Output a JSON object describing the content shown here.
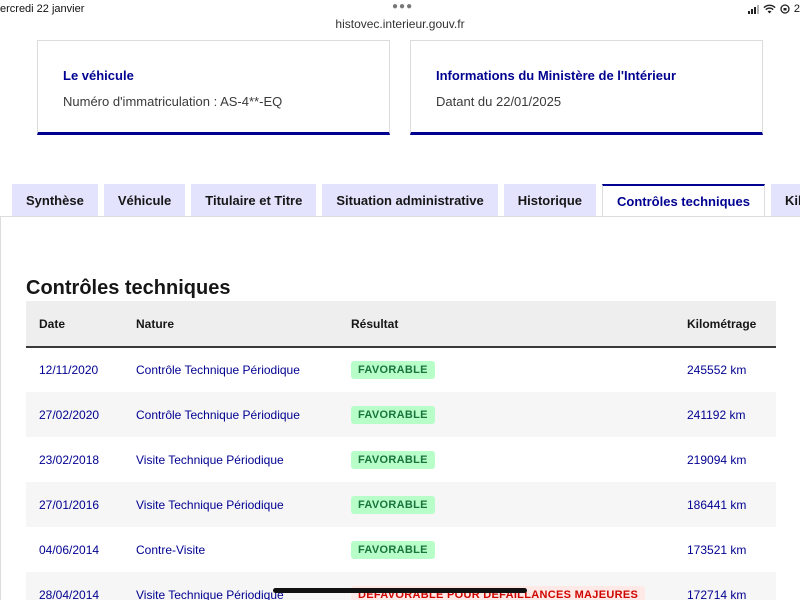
{
  "status_bar": {
    "date": "ercredi 22 janvier",
    "url": "histovec.interieur.gouv.fr",
    "battery": "2"
  },
  "cards": [
    {
      "title": "Le véhicule",
      "text": "Numéro d'immatriculation : AS-4**-EQ"
    },
    {
      "title": "Informations du Ministère de l'Intérieur",
      "text": "Datant du 22/01/2025"
    }
  ],
  "tabs": [
    {
      "label": "Synthèse",
      "active": false
    },
    {
      "label": "Véhicule",
      "active": false
    },
    {
      "label": "Titulaire et Titre",
      "active": false
    },
    {
      "label": "Situation administrative",
      "active": false
    },
    {
      "label": "Historique",
      "active": false
    },
    {
      "label": "Contrôles techniques",
      "active": true
    },
    {
      "label": "Kil",
      "active": false
    }
  ],
  "section": {
    "title": "Contrôles techniques",
    "columns": [
      "Date",
      "Nature",
      "Résultat",
      "Kilométrage"
    ],
    "rows": [
      {
        "date": "12/11/2020",
        "nature": "Contrôle Technique Périodique",
        "result": "FAVORABLE",
        "km": "245552 km"
      },
      {
        "date": "27/02/2020",
        "nature": "Contrôle Technique Périodique",
        "result": "FAVORABLE",
        "km": "241192 km"
      },
      {
        "date": "23/02/2018",
        "nature": "Visite Technique Périodique",
        "result": "FAVORABLE",
        "km": "219094 km"
      },
      {
        "date": "27/01/2016",
        "nature": "Visite Technique Périodique",
        "result": "FAVORABLE",
        "km": "186441 km"
      },
      {
        "date": "04/06/2014",
        "nature": "Contre-Visite",
        "result": "FAVORABLE",
        "km": "173521 km"
      },
      {
        "date": "28/04/2014",
        "nature": "Visite Technique Périodique",
        "result": "DEFAVORABLE POUR DEFAILLANCES MAJEURES",
        "km": "172714 km"
      }
    ]
  }
}
